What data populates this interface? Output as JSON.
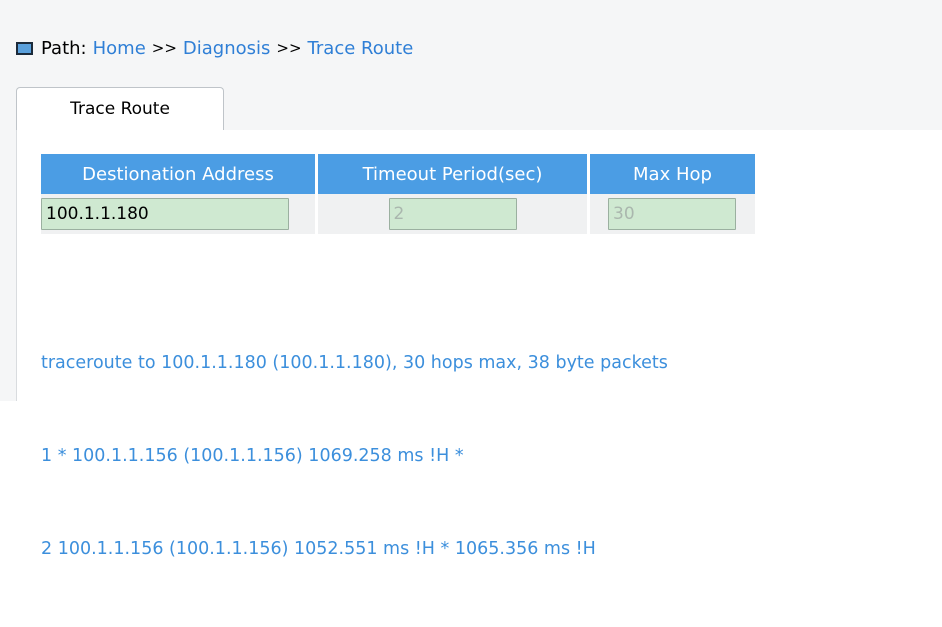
{
  "path": {
    "label": "Path:",
    "crumbs": [
      "Home",
      "Diagnosis",
      "Trace Route"
    ],
    "separator": ">>"
  },
  "tabs": [
    {
      "label": "Trace Route",
      "active": true
    }
  ],
  "form": {
    "headers": [
      "Destionation Address",
      "Timeout Period(sec)",
      "Max Hop"
    ],
    "destination_value": "100.1.1.180",
    "timeout_value": "2",
    "maxhop_value": "30"
  },
  "output": {
    "lines": [
      "traceroute to 100.1.1.180 (100.1.1.180), 30 hops max, 38 byte packets",
      "1 * 100.1.1.156 (100.1.1.156) 1069.258 ms !H *",
      "2 100.1.1.156 (100.1.1.156) 1052.551 ms !H * 1065.356 ms !H"
    ]
  },
  "colors": {
    "header_bg": "#4b9de4",
    "link": "#2f7fd6",
    "output_text": "#3c8fdc",
    "input_bg": "#cfe9d1"
  }
}
